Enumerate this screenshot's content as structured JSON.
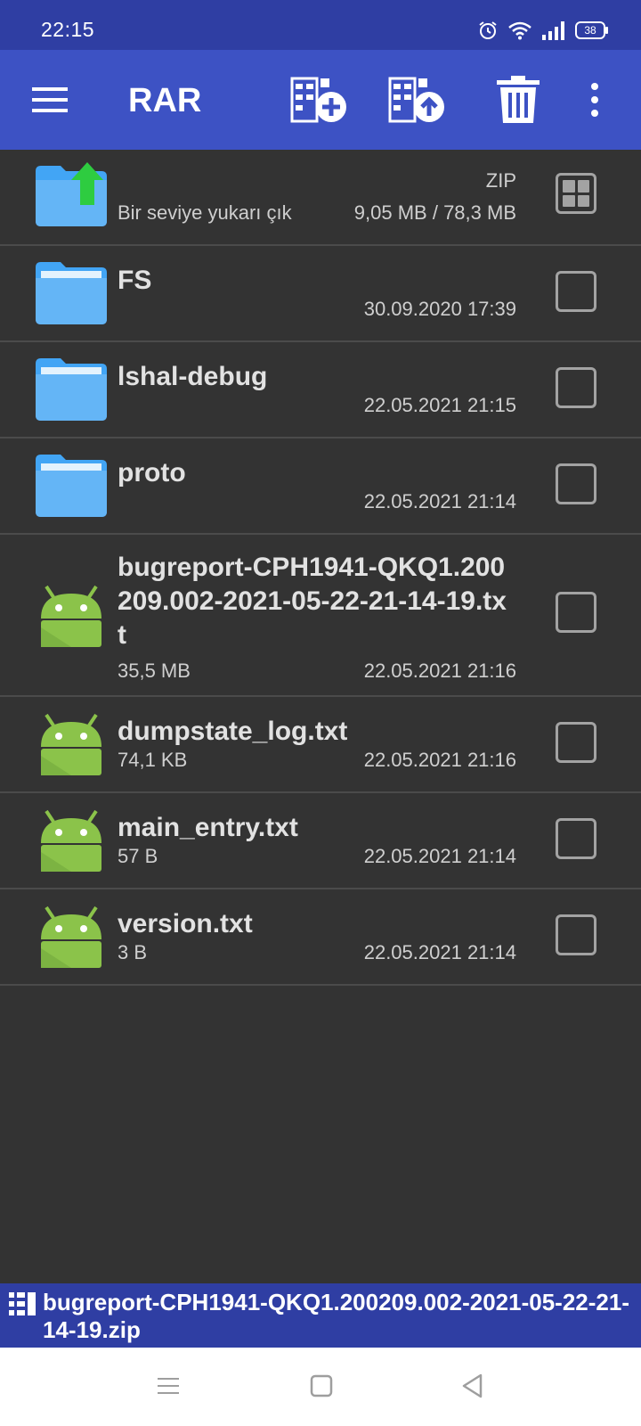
{
  "status_bar": {
    "time": "22:15",
    "battery": "38"
  },
  "toolbar": {
    "title": "RAR"
  },
  "up_row": {
    "label": "Bir seviye yukarı çık",
    "archive_type": "ZIP",
    "size": "9,05 MB / 78,3 MB"
  },
  "items": [
    {
      "type": "folder",
      "name": "FS",
      "size": "",
      "date": "30.09.2020 17:39"
    },
    {
      "type": "folder",
      "name": "lshal-debug",
      "size": "",
      "date": "22.05.2021 21:15"
    },
    {
      "type": "folder",
      "name": "proto",
      "size": "",
      "date": "22.05.2021 21:14"
    },
    {
      "type": "file",
      "name": "bugreport-CPH1941-QKQ1.200209.002-2021-05-22-21-14-19.txt",
      "size": "35,5 MB",
      "date": "22.05.2021 21:16"
    },
    {
      "type": "file",
      "name": "dumpstate_log.txt",
      "size": "74,1 KB",
      "date": "22.05.2021 21:16"
    },
    {
      "type": "file",
      "name": "main_entry.txt",
      "size": "57 B",
      "date": "22.05.2021 21:14"
    },
    {
      "type": "file",
      "name": "version.txt",
      "size": "3 B",
      "date": "22.05.2021 21:14"
    }
  ],
  "path_bar": {
    "path": "bugreport-CPH1941-QKQ1.200209.002-2021-05-22-21-14-19.zip"
  },
  "colors": {
    "header": "#3d52c4",
    "status": "#2f3ea3",
    "background": "#333333",
    "folder": "#42a5f5",
    "android": "#8bc34a"
  }
}
